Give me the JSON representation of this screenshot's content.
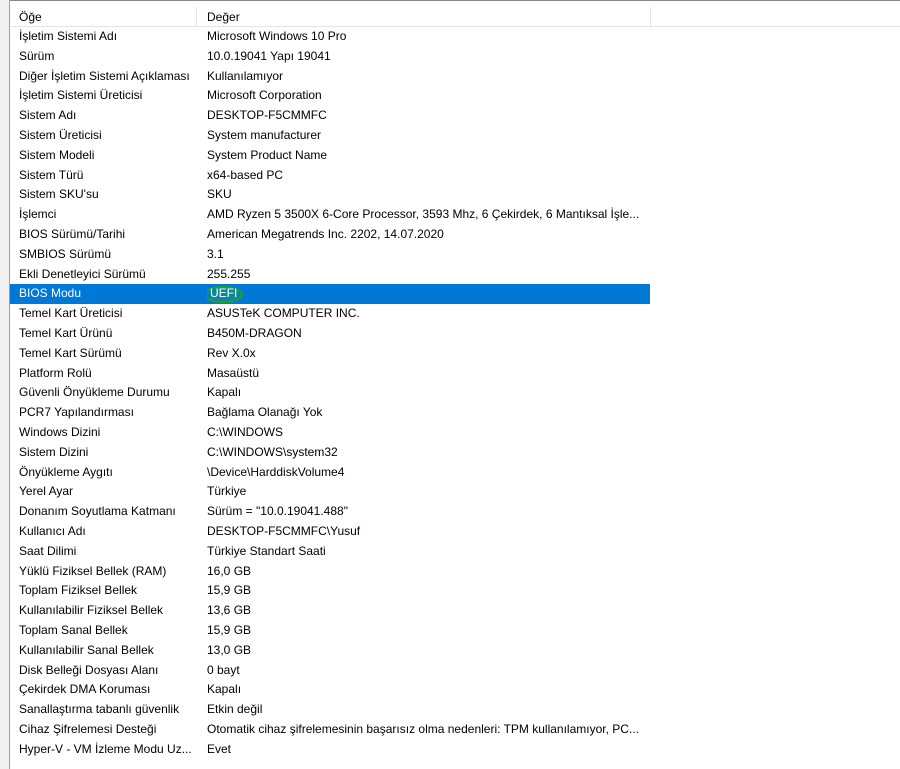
{
  "header": {
    "col_item": "Öğe",
    "col_value": "Değer"
  },
  "rows": [
    {
      "item": "İşletim Sistemi Adı",
      "value": "Microsoft Windows 10 Pro"
    },
    {
      "item": "Sürüm",
      "value": "10.0.19041 Yapı 19041"
    },
    {
      "item": "Diğer İşletim Sistemi Açıklaması",
      "value": "Kullanılamıyor"
    },
    {
      "item": "İşletim Sistemi Üreticisi",
      "value": "Microsoft Corporation"
    },
    {
      "item": "Sistem Adı",
      "value": "DESKTOP-F5CMMFC"
    },
    {
      "item": "Sistem Üreticisi",
      "value": "System manufacturer"
    },
    {
      "item": "Sistem Modeli",
      "value": "System Product Name"
    },
    {
      "item": "Sistem Türü",
      "value": "x64-based PC"
    },
    {
      "item": "Sistem SKU'su",
      "value": "SKU"
    },
    {
      "item": "İşlemci",
      "value": "AMD Ryzen 5 3500X 6-Core Processor, 3593 Mhz, 6 Çekirdek, 6 Mantıksal İşle..."
    },
    {
      "item": "BIOS Sürümü/Tarihi",
      "value": "American Megatrends Inc. 2202, 14.07.2020"
    },
    {
      "item": "SMBIOS Sürümü",
      "value": "3.1"
    },
    {
      "item": "Ekli Denetleyici Sürümü",
      "value": "255.255"
    },
    {
      "item": "BIOS Modu",
      "value": "UEFI"
    },
    {
      "item": "Temel Kart Üreticisi",
      "value": "ASUSTeK COMPUTER INC."
    },
    {
      "item": "Temel Kart Ürünü",
      "value": "B450M-DRAGON"
    },
    {
      "item": "Temel Kart Sürümü",
      "value": "Rev X.0x"
    },
    {
      "item": "Platform Rolü",
      "value": "Masaüstü"
    },
    {
      "item": "Güvenli Önyükleme Durumu",
      "value": "Kapalı"
    },
    {
      "item": "PCR7 Yapılandırması",
      "value": "Bağlama Olanağı Yok"
    },
    {
      "item": "Windows Dizini",
      "value": "C:\\WINDOWS"
    },
    {
      "item": "Sistem Dizini",
      "value": "C:\\WINDOWS\\system32"
    },
    {
      "item": "Önyükleme Aygıtı",
      "value": "\\Device\\HarddiskVolume4"
    },
    {
      "item": "Yerel Ayar",
      "value": "Türkiye"
    },
    {
      "item": "Donanım Soyutlama Katmanı",
      "value": "Sürüm = \"10.0.19041.488\""
    },
    {
      "item": "Kullanıcı Adı",
      "value": "DESKTOP-F5CMMFC\\Yusuf"
    },
    {
      "item": "Saat Dilimi",
      "value": "Türkiye Standart Saati"
    },
    {
      "item": "Yüklü Fiziksel Bellek (RAM)",
      "value": "16,0 GB"
    },
    {
      "item": "Toplam Fiziksel Bellek",
      "value": "15,9 GB"
    },
    {
      "item": "Kullanılabilir Fiziksel Bellek",
      "value": "13,6 GB"
    },
    {
      "item": "Toplam Sanal Bellek",
      "value": "15,9 GB"
    },
    {
      "item": "Kullanılabilir Sanal Bellek",
      "value": "13,0 GB"
    },
    {
      "item": "Disk Belleği Dosyası Alanı",
      "value": "0 bayt"
    },
    {
      "item": "Çekirdek DMA Koruması",
      "value": "Kapalı"
    },
    {
      "item": "Sanallaştırma tabanlı güvenlik",
      "value": "Etkin değil"
    },
    {
      "item": "Cihaz Şifrelemesi Desteği",
      "value": "Otomatik cihaz şifrelemesinin başarısız olma nedenleri: TPM kullanılamıyor, PC..."
    },
    {
      "item": "Hyper-V - VM İzleme Modu Uz...",
      "value": "Evet"
    }
  ],
  "selected_row": 13,
  "colors": {
    "selection": "#0078d7",
    "highlight_marker": "#22a12a"
  }
}
